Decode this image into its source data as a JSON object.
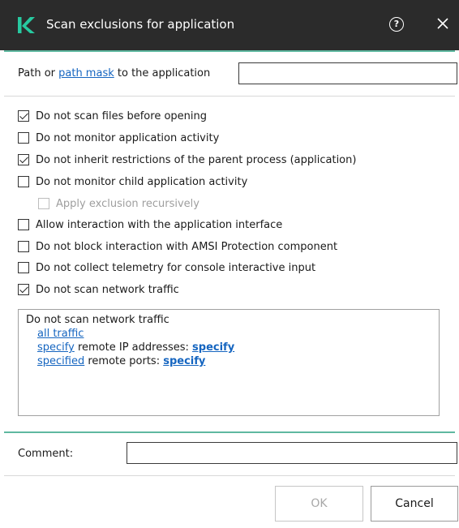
{
  "window": {
    "title": "Scan exclusions for application",
    "help_glyph": "?",
    "logo_icon": "kaspersky-k-logo",
    "accent_color": "#5fb8a0"
  },
  "path": {
    "prefix": "Path or ",
    "link": "path mask",
    "suffix": " to the application",
    "value": ""
  },
  "options": [
    {
      "label": "Do not scan files before opening",
      "checked": true,
      "enabled": true
    },
    {
      "label": "Do not monitor application activity",
      "checked": false,
      "enabled": true
    },
    {
      "label": "Do not inherit restrictions of the parent process (application)",
      "checked": true,
      "enabled": true
    },
    {
      "label": "Do not monitor child application activity",
      "checked": false,
      "enabled": true
    },
    {
      "label": "Apply exclusion recursively",
      "checked": false,
      "enabled": false
    },
    {
      "label": "Allow interaction with the application interface",
      "checked": false,
      "enabled": true
    },
    {
      "label": "Do not block interaction with AMSI Protection component",
      "checked": false,
      "enabled": true
    },
    {
      "label": "Do not collect telemetry for console interactive input",
      "checked": false,
      "enabled": true
    },
    {
      "label": "Do not scan network traffic",
      "checked": true,
      "enabled": true
    }
  ],
  "traffic_panel": {
    "title": "Do not scan network traffic",
    "all_traffic": "all traffic",
    "ip_link": "specify",
    "ip_text": " remote IP addresses: ",
    "ip_value": "specify",
    "ports_link": "specified",
    "ports_text": " remote ports: ",
    "ports_value": "specify"
  },
  "comment": {
    "label": "Comment:",
    "value": ""
  },
  "buttons": {
    "ok": "OK",
    "cancel": "Cancel"
  }
}
